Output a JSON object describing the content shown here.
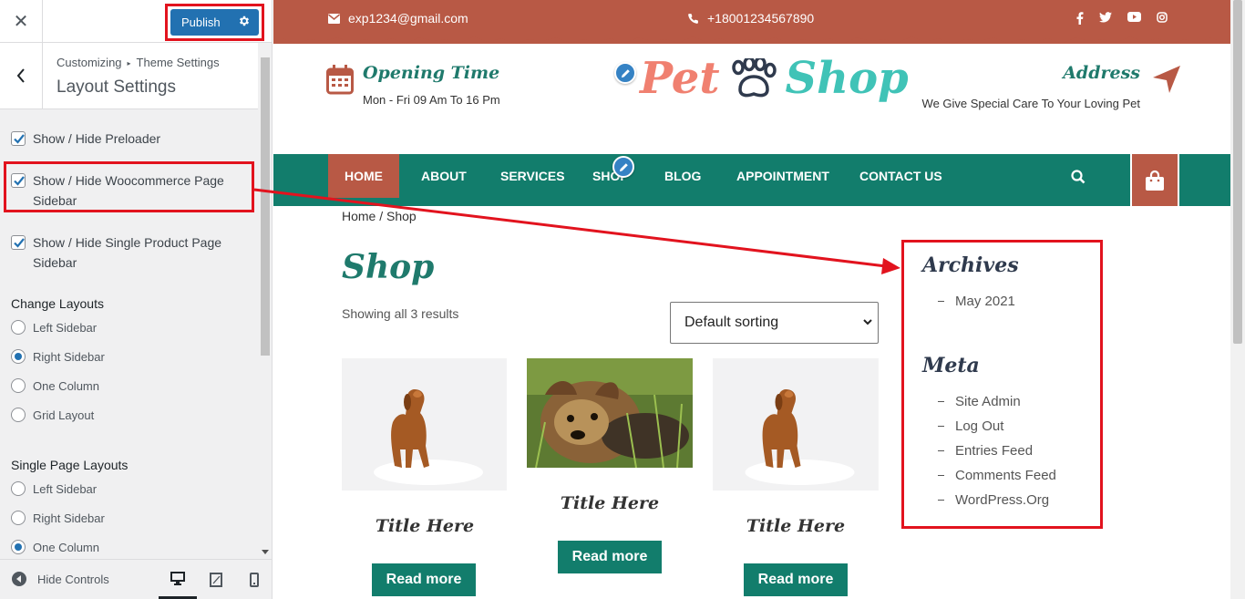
{
  "customizer": {
    "publish_label": "Publish",
    "breadcrumb_root": "Customizing",
    "breadcrumb_parent": "Theme Settings",
    "section_title": "Layout Settings",
    "checkboxes": [
      {
        "label": "Show / Hide Preloader",
        "checked": true
      },
      {
        "label": "Show / Hide Woocommerce Page Sidebar",
        "checked": true
      },
      {
        "label": "Show / Hide Single Product Page Sidebar",
        "checked": true
      }
    ],
    "change_layouts": {
      "title": "Change Layouts",
      "options": [
        "Left Sidebar",
        "Right Sidebar",
        "One Column",
        "Grid Layout"
      ],
      "selected": "Right Sidebar"
    },
    "single_page_layouts": {
      "title": "Single Page Layouts",
      "options": [
        "Left Sidebar",
        "Right Sidebar",
        "One Column"
      ],
      "selected": "One Column"
    },
    "hide_controls_label": "Hide Controls",
    "devices": [
      "desktop",
      "tablet",
      "mobile"
    ],
    "active_device": "desktop"
  },
  "site": {
    "topbar": {
      "email": "exp1234@gmail.com",
      "phone": "+18001234567890",
      "social_icons": [
        "facebook-icon",
        "twitter-icon",
        "youtube-icon",
        "instagram-icon"
      ]
    },
    "opening": {
      "title": "Opening Time",
      "text": "Mon - Fri 09 Am To 16 Pm"
    },
    "logo": {
      "word1": "Pet",
      "word2": "Shop"
    },
    "address": {
      "title": "Address",
      "text": "We Give Special Care To Your Loving Pet"
    },
    "nav": {
      "items": [
        "HOME",
        "ABOUT",
        "SERVICES",
        "SHOP",
        "BLOG",
        "APPOINTMENT",
        "CONTACT US"
      ],
      "active": "HOME"
    },
    "breadcrumb": "Home / Shop",
    "page_title": "Shop",
    "results": "Showing all 3 results",
    "sort_selected": "Default sorting",
    "products": [
      {
        "title": "Title Here",
        "button": "Read more"
      },
      {
        "title": "Title Here",
        "button": "Read more"
      },
      {
        "title": "Title Here",
        "button": "Read more"
      }
    ],
    "sidebar": {
      "archives_title": "Archives",
      "archives": [
        "May 2021"
      ],
      "meta_title": "Meta",
      "meta": [
        "Site Admin",
        "Log Out",
        "Entries Feed",
        "Comments Feed",
        "WordPress.Org"
      ]
    }
  },
  "colors": {
    "brand_rust": "#b85945",
    "brand_teal": "#127d6c",
    "publish_blue": "#2271b1",
    "highlight_red": "#e2131e"
  }
}
